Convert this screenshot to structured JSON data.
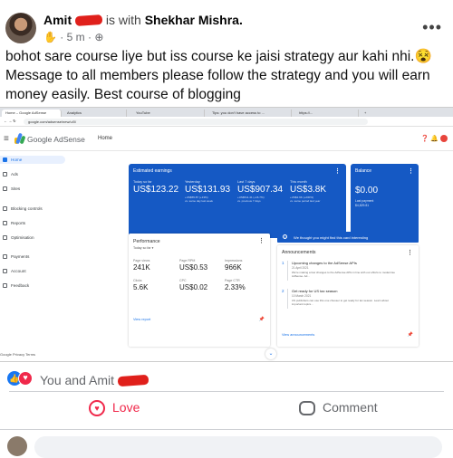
{
  "post": {
    "author": "Amit",
    "with_text": "is with",
    "tagged": "Shekhar Mishra.",
    "time": "5 m",
    "text": "bohot sare course liye but iss course ke jaisi strategy aur kahi nhi.😵 Message to all members please follow the strategy and you will earn money easily. Best course of blogging"
  },
  "screenshot": {
    "tabs": [
      "Home – Google AdSense",
      "Analytics",
      "YouTube",
      "Tips: you don't have access to ...",
      "https://...",
      "+"
    ],
    "url": "google.com/adsense/new/u/0/",
    "app_title": "Google AdSense",
    "page": "Home",
    "nav": [
      "Home",
      "Ads",
      "Sites",
      "Blocking controls",
      "Reports",
      "Optimisation",
      "Payments",
      "Account",
      "Feedback"
    ],
    "footer": "Google  Privacy  Terms",
    "earnings": {
      "title": "Estimated earnings",
      "cols": [
        {
          "label": "Today so far",
          "value": "US$123.22",
          "sub": ""
        },
        {
          "label": "Yesterday",
          "value": "US$131.93",
          "sub": "+US$55.87 (+13%)\nvs. same day last week"
        },
        {
          "label": "Last 7 days",
          "value": "US$907.34",
          "sub": "+US$511.41 (+16.7%)\nvs. previous 7 days"
        },
        {
          "label": "This month",
          "value": "US$3.8K",
          "sub": "+US$2.9K (+230%)\nvs. same period last year"
        }
      ]
    },
    "balance": {
      "title": "Balance",
      "value": "$0.00",
      "sub": "Last payment\n$4,829.81"
    },
    "recommendation": "We thought you might find this card interesting",
    "performance": {
      "title": "Performance",
      "subtitle": "Today so far ▾",
      "metrics": [
        {
          "label": "Page views",
          "value": "241K"
        },
        {
          "label": "Page RPM",
          "value": "US$0.53"
        },
        {
          "label": "Impressions",
          "value": "966K"
        },
        {
          "label": "Clicks",
          "value": "5.6K"
        },
        {
          "label": "CPC",
          "value": "US$0.02"
        },
        {
          "label": "Page CTR",
          "value": "2.33%"
        }
      ],
      "link": "View report"
    },
    "announcements": {
      "title": "Announcements",
      "items": [
        {
          "num": "1",
          "head": "Upcoming changes to the AdSense APIs",
          "date": "21 April 2021",
          "body": "We're making a few changes to the AdSense APIs in line with our efforts to modernise AdSense. Ad..."
        },
        {
          "num": "2",
          "head": "Get ready for US tax season",
          "date": "10 March 2021",
          "body": "US publishers can use this one chooser to get ready for tax season. Learn about important topics..."
        }
      ],
      "link": "View announcements"
    }
  },
  "reactions": {
    "text": "You and Amit"
  },
  "actions": {
    "love": "Love",
    "comment": "Comment"
  },
  "colors": {
    "facebook_blue": "#1877f2",
    "love_red": "#f0284a",
    "adsense_blue": "#1559c4",
    "redaction": "#e0201b"
  }
}
